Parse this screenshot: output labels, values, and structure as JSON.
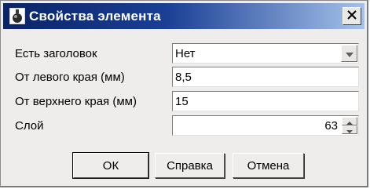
{
  "window": {
    "title": "Свойства элемента",
    "icons": {
      "app": "bottle-icon",
      "close": "close-icon"
    }
  },
  "form": {
    "has_header": {
      "label": "Есть заголовок",
      "value": "Нет"
    },
    "left_margin": {
      "label": "От левого края (мм)",
      "value": "8,5"
    },
    "top_margin": {
      "label": "От верхнего края (мм)",
      "value": "15"
    },
    "layer": {
      "label": "Слой",
      "value": "63"
    }
  },
  "buttons": {
    "ok": "ОК",
    "help": "Справка",
    "cancel": "Отмена"
  },
  "colors": {
    "title_gradient_start": "#0a2466",
    "title_gradient_end": "#a6c2ea",
    "dialog_bg": "#eeedeb"
  }
}
